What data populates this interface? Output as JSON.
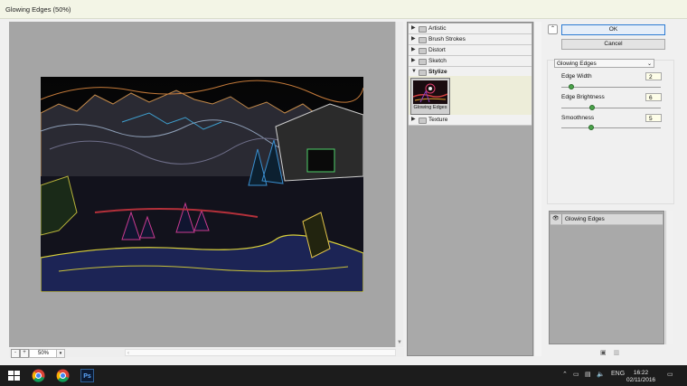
{
  "dialog": {
    "title": "Glowing Edges (50%)"
  },
  "preview": {
    "zoom_value": "50%",
    "zoom_out_label": "-",
    "zoom_in_label": "+"
  },
  "filter_browser": {
    "categories": [
      {
        "label": "Artistic",
        "expanded": false
      },
      {
        "label": "Brush Strokes",
        "expanded": false
      },
      {
        "label": "Distort",
        "expanded": false
      },
      {
        "label": "Sketch",
        "expanded": false
      },
      {
        "label": "Stylize",
        "expanded": true
      },
      {
        "label": "Texture",
        "expanded": false
      }
    ],
    "selected_thumbnail_label": "Glowing Edges"
  },
  "buttons": {
    "ok": "OK",
    "cancel": "Cancel"
  },
  "settings": {
    "filter_select": "Glowing Edges",
    "params": [
      {
        "label": "Edge Width",
        "value": "2",
        "min": 1,
        "max": 14,
        "level": 2
      },
      {
        "label": "Edge Brightness",
        "value": "6",
        "min": 0,
        "max": 20,
        "level": 6
      },
      {
        "label": "Smoothness",
        "value": "5",
        "min": 1,
        "max": 15,
        "level": 5
      }
    ]
  },
  "layers": {
    "item_label": "Glowing Edges"
  },
  "taskbar": {
    "ps_label": "Ps",
    "language": "ENG",
    "time": "16:22",
    "date": "02/11/2016"
  },
  "colors": {
    "ok_border": "#2d7bd3",
    "slider_knob": "#4aa34a",
    "title_bg": "#f3f5e6"
  },
  "icons": [
    "collapse-arrow-icon",
    "folder-icon",
    "eye-icon",
    "new-layer-icon",
    "trash-icon",
    "windows-start-icon",
    "chrome-icon",
    "speaker-icon",
    "network-icon",
    "notification-icon"
  ]
}
